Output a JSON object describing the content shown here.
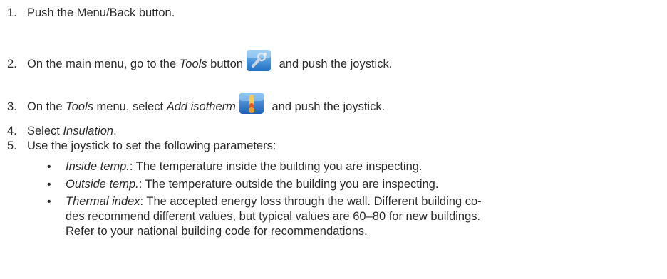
{
  "steps": [
    {
      "number": "1.",
      "parts": [
        "Push the Menu/Back button."
      ]
    },
    {
      "number": "2.",
      "parts": [
        "On the main menu, go to the ",
        "Tools",
        " button",
        " and push the joystick."
      ],
      "icon": "tools-icon"
    },
    {
      "number": "3.",
      "parts": [
        "On the ",
        "Tools",
        " menu, select ",
        "Add isotherm",
        " and push the joystick."
      ],
      "icon": "add-isotherm-icon"
    },
    {
      "number": "4.",
      "parts": [
        "Select ",
        "Insulation",
        "."
      ]
    },
    {
      "number": "5.",
      "parts": [
        "Use the joystick to set the following parameters:"
      ]
    }
  ],
  "parameters": [
    {
      "term": "Inside temp.",
      "description": ": The temperature inside the building you are inspecting."
    },
    {
      "term": "Outside temp.",
      "description": ": The temperature outside the building you are inspecting."
    },
    {
      "term": "Thermal index",
      "description_line1": ": The accepted energy loss through the wall. Different building co-",
      "description_line2": "des recommend different values, but typical values are 60–80 for new buildings.",
      "description_line3": "Refer to your national building code for recommendations."
    }
  ],
  "bullet_glyph": "•",
  "colors": {
    "text": "#2b2b2b",
    "icon_blue": "#1f6fc4",
    "icon_orange": "#f0a020"
  }
}
